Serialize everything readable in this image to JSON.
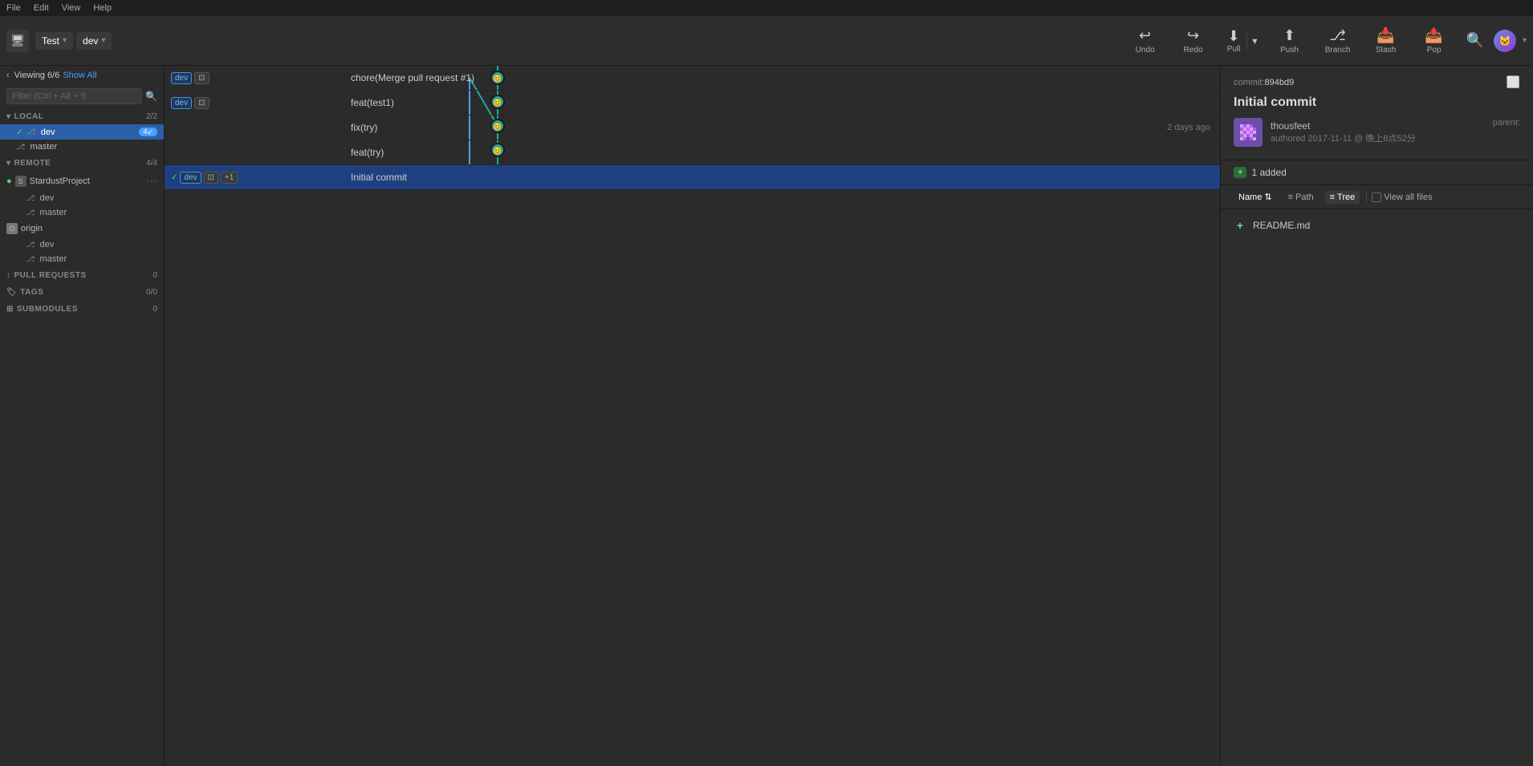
{
  "menubar": {
    "items": [
      "File",
      "Edit",
      "View",
      "Help"
    ]
  },
  "titlebar": {
    "app_icon": "📁",
    "repo_name": "Test",
    "branch_name": "dev"
  },
  "toolbar": {
    "buttons": [
      {
        "id": "undo",
        "icon": "↩",
        "label": "Undo"
      },
      {
        "id": "redo",
        "icon": "↪",
        "label": "Redo"
      },
      {
        "id": "pull",
        "icon": "⬇",
        "label": "Pull"
      },
      {
        "id": "push",
        "icon": "⬆",
        "label": "Push"
      },
      {
        "id": "branch",
        "icon": "⎇",
        "label": "Branch"
      },
      {
        "id": "stash",
        "icon": "📦",
        "label": "Stash"
      },
      {
        "id": "pop",
        "icon": "📤",
        "label": "Pop"
      }
    ]
  },
  "sidebar": {
    "viewing_label": "Viewing 6/6",
    "show_all": "Show All",
    "filter_placeholder": "Filter (Ctrl + Alt + f)",
    "local_section": {
      "title": "LOCAL",
      "count": "2/2",
      "branches": [
        {
          "name": "dev",
          "active": true,
          "checked": true,
          "badge": "4↙"
        },
        {
          "name": "master",
          "active": false,
          "checked": false
        }
      ]
    },
    "remote_section": {
      "title": "REMOTE",
      "count": "4/4",
      "groups": [
        {
          "name": "StardustProject",
          "branches": [
            "dev",
            "master"
          ]
        },
        {
          "name": "origin",
          "branches": [
            "dev",
            "master"
          ]
        }
      ]
    },
    "pull_requests": {
      "title": "PULL REQUESTS",
      "count": "0"
    },
    "tags": {
      "title": "TAGS",
      "count": "0/0"
    },
    "submodules": {
      "title": "SUBMODULES",
      "count": "0"
    }
  },
  "commits": [
    {
      "id": "c1",
      "message": "chore(Merge pull request #1)",
      "time": "",
      "tags": [
        "dev"
      ],
      "selected": false,
      "graph_row": 0
    },
    {
      "id": "c2",
      "message": "feat(test1)",
      "time": "",
      "tags": [
        "dev"
      ],
      "selected": false,
      "graph_row": 1
    },
    {
      "id": "c3",
      "message": "fix(try)",
      "time": "2 days ago",
      "tags": [],
      "selected": false,
      "graph_row": 2
    },
    {
      "id": "c4",
      "message": "feat(try)",
      "time": "",
      "tags": [],
      "selected": false,
      "graph_row": 3
    },
    {
      "id": "c5",
      "message": "Initial commit",
      "time": "",
      "tags": [
        "dev",
        "+1"
      ],
      "selected": true,
      "graph_row": 4
    }
  ],
  "right_panel": {
    "commit_label": "commit:",
    "commit_hash": "894bd9",
    "commit_title": "Initial commit",
    "author": {
      "name": "thousfeet",
      "time": "authored 2017-11-11 @ 晚上8点52分"
    },
    "parent_label": "parent:",
    "files_count": "1 added",
    "sort_label": "Name",
    "path_label": "Path",
    "tree_label": "Tree",
    "view_all_label": "View all files",
    "files": [
      {
        "name": "README.md",
        "status": "+"
      }
    ]
  }
}
